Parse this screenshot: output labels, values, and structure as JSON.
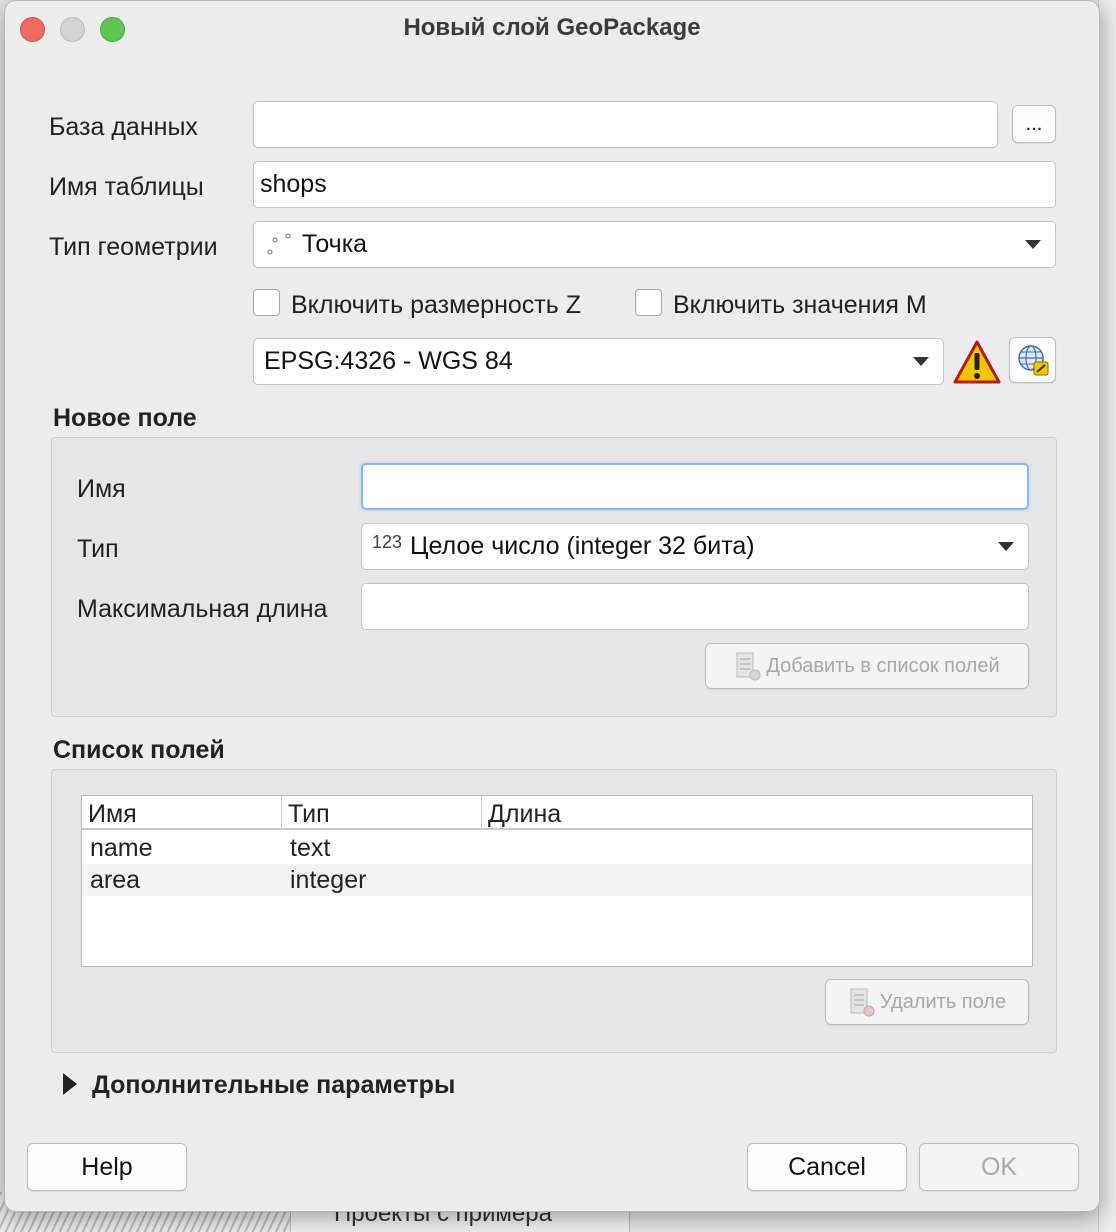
{
  "window": {
    "title": "Новый слой GeoPackage"
  },
  "background": {
    "bottom_text": "Проекты с примера"
  },
  "form": {
    "database_label": "База данных",
    "database_value": "",
    "browse_label": "...",
    "table_name_label": "Имя таблицы",
    "table_name_value": "shops",
    "geometry_type_label": "Тип геометрии",
    "geometry_type_value": "Точка",
    "include_z_label": "Включить размерность Z",
    "include_m_label": "Включить значения M",
    "crs_value": "EPSG:4326 - WGS 84"
  },
  "new_field": {
    "section_title": "Новое поле",
    "name_label": "Имя",
    "name_value": "",
    "type_label": "Тип",
    "type_prefix": "123",
    "type_value": "Целое число (integer 32 бита)",
    "max_length_label": "Максимальная длина",
    "max_length_value": "",
    "add_button_label": "Добавить в список полей"
  },
  "field_list": {
    "section_title": "Список полей",
    "columns": [
      "Имя",
      "Тип",
      "Длина"
    ],
    "rows": [
      {
        "name": "name",
        "type": "text",
        "length": ""
      },
      {
        "name": "area",
        "type": "integer",
        "length": ""
      }
    ],
    "remove_button_label": "Удалить поле"
  },
  "advanced": {
    "label": "Дополнительные параметры"
  },
  "footer": {
    "help_label": "Help",
    "cancel_label": "Cancel",
    "ok_label": "OK"
  },
  "colors": {
    "close": "#ed6a5e",
    "maximize": "#61c554",
    "warning": "#f5c400",
    "focus": "#8fb5e8"
  }
}
